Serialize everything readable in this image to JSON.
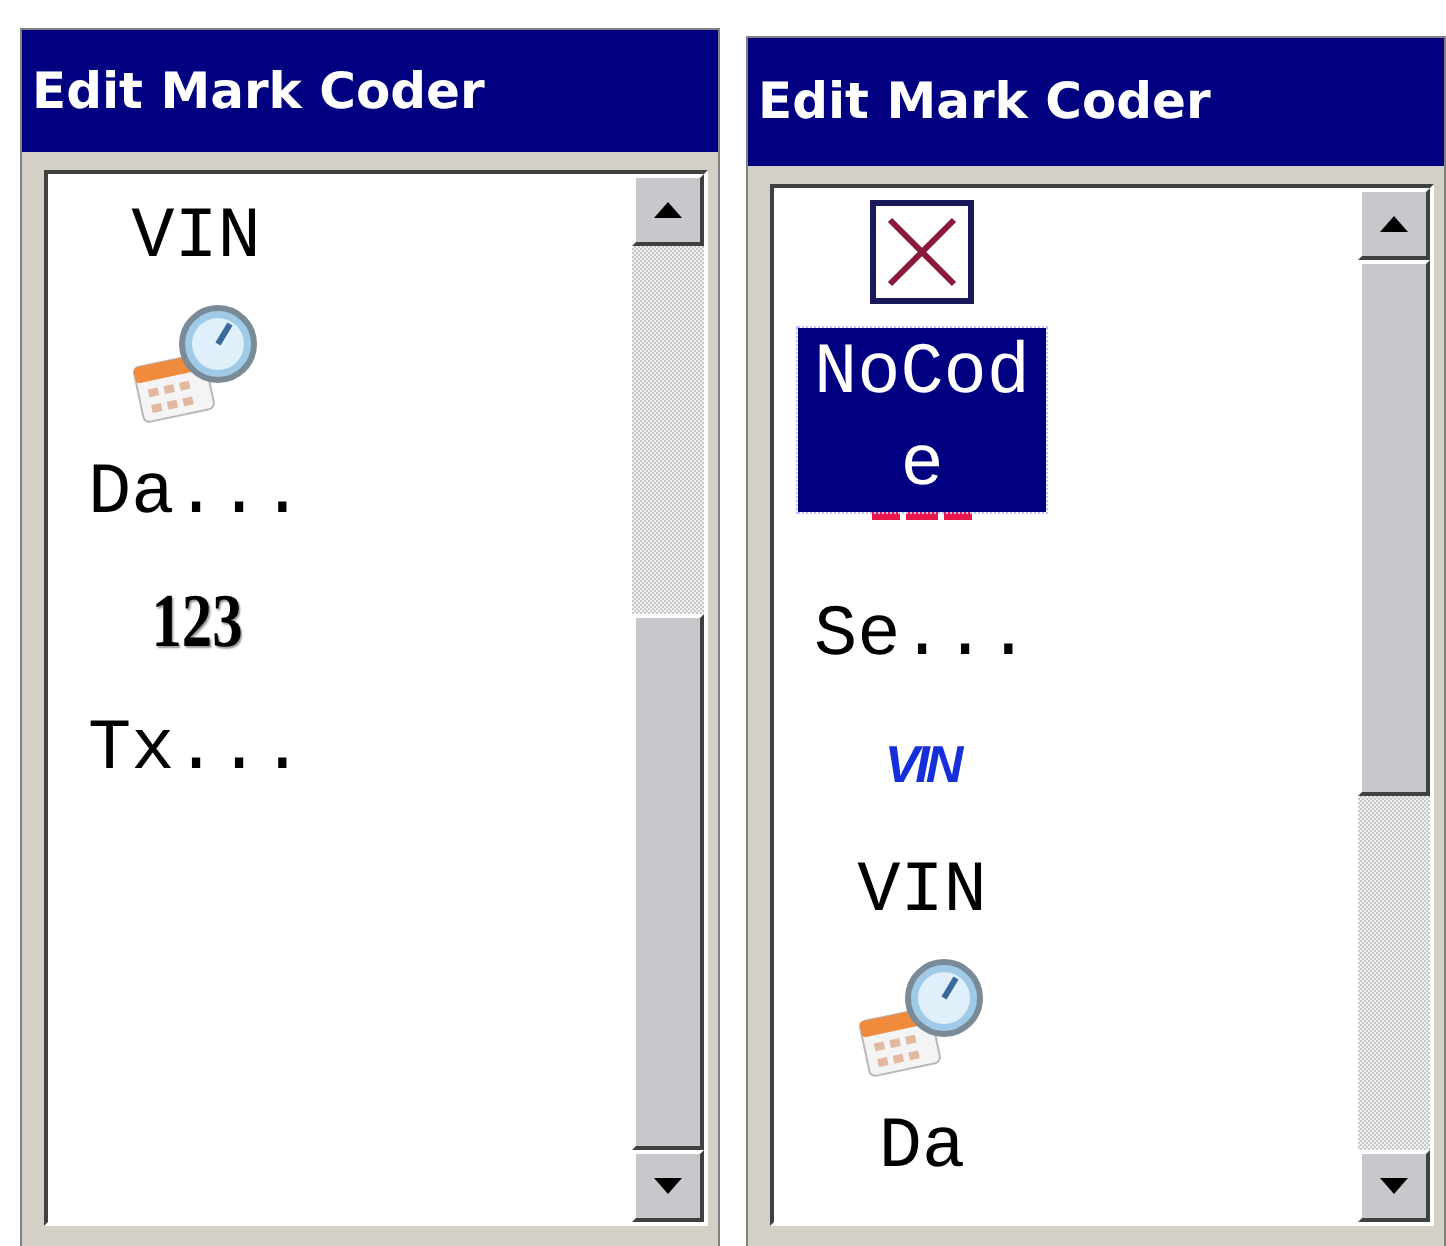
{
  "panels": [
    {
      "title": "Edit Mark Coder",
      "items": [
        {
          "kind": "text",
          "text": "VIN",
          "selected": false
        },
        {
          "kind": "calendar"
        },
        {
          "kind": "text",
          "text": "Da...",
          "selected": false
        },
        {
          "kind": "number",
          "text": "123"
        },
        {
          "kind": "text",
          "text": "Tx...",
          "selected": false
        }
      ]
    },
    {
      "title": "Edit Mark Coder",
      "items": [
        {
          "kind": "nocode"
        },
        {
          "kind": "text",
          "text": "NoCode",
          "selected": true
        },
        {
          "kind": "number-hidden"
        },
        {
          "kind": "text",
          "text": "Se...",
          "selected": false
        },
        {
          "kind": "vin",
          "text": "VIN"
        },
        {
          "kind": "text",
          "text": "VIN",
          "selected": false
        },
        {
          "kind": "calendar"
        },
        {
          "kind": "text",
          "text": "Da",
          "selected": false
        }
      ]
    }
  ]
}
